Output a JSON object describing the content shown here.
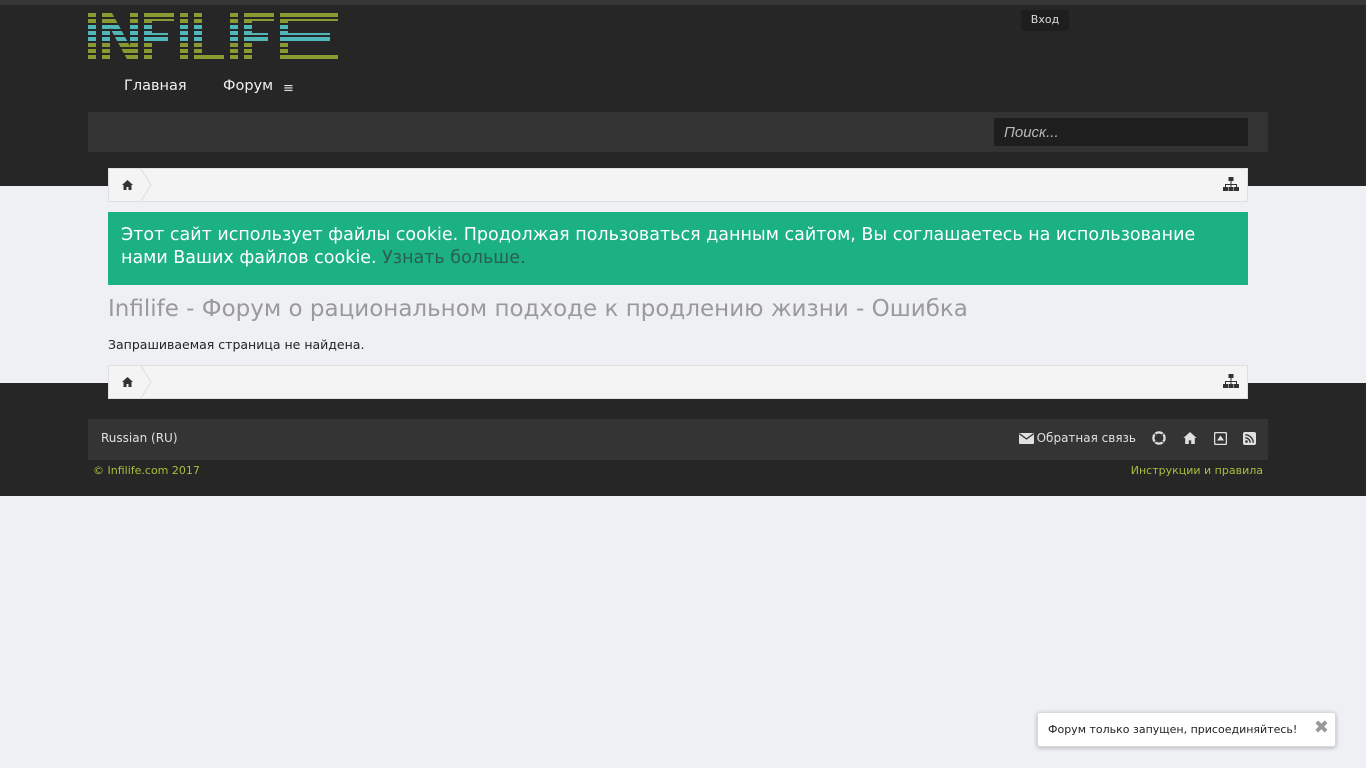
{
  "header": {
    "logo_text": "INFILIFE",
    "login_label": "Вход",
    "nav": [
      {
        "label": "Главная"
      },
      {
        "label": "Форум"
      }
    ],
    "search_placeholder": "Поиск..."
  },
  "cookie_notice": {
    "text": "Этот сайт использует файлы cookie. Продолжая пользоваться данным сайтом, Вы соглашаетесь на использование нами Ваших файлов cookie.",
    "link_label": "Узнать больше."
  },
  "main": {
    "title": "Infilife - Форум о рациональном подходе к продлению жизни - Ошибка",
    "error_message": "Запрашиваемая страница не найдена."
  },
  "footer": {
    "language": "Russian (RU)",
    "contact_label": "Обратная связь",
    "copyright": "© Infilife.com 2017",
    "rules_link": "Инструкции и правила"
  },
  "notice": {
    "text": "Форум только запущен, присоединяйтесь!"
  },
  "colors": {
    "header_bg": "#262626",
    "accent_green": "#1bb183",
    "footer_link": "#a9be3c"
  }
}
